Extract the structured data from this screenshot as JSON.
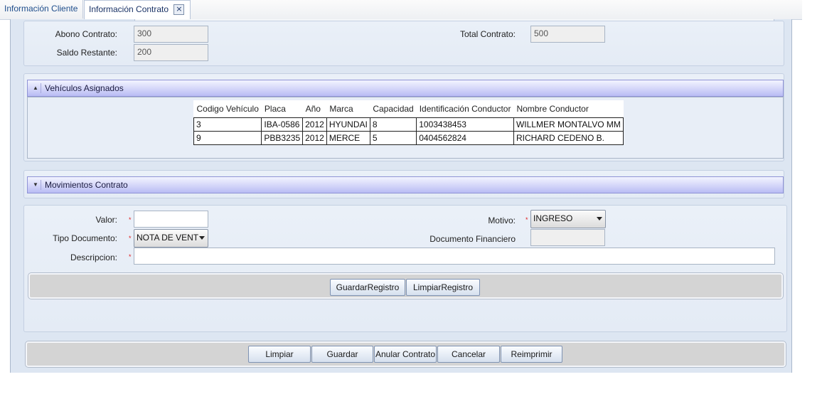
{
  "tabs": [
    {
      "label": "Información Cliente"
    },
    {
      "label": "Información Contrato",
      "close": "×"
    }
  ],
  "contract_summary": {
    "abono_label": "Abono Contrato:",
    "abono_value": "300",
    "total_label": "Total Contrato:",
    "total_value": "500",
    "saldo_label": "Saldo Restante:",
    "saldo_value": "200"
  },
  "vehiculos": {
    "title": "Vehículos Asignados",
    "expanded": true,
    "columns": [
      "Codigo Vehículo",
      "Placa",
      "Año",
      "Marca",
      "Capacidad",
      "Identificación Conductor",
      "Nombre Conductor"
    ],
    "rows": [
      [
        "3",
        "IBA-0586",
        "2012",
        "HYUNDAI",
        "8",
        "1003438453",
        "WILLMER MONTALVO MM"
      ],
      [
        "9",
        "PBB3235",
        "2012",
        "MERCE",
        "5",
        "0404562824",
        "RICHARD CEDENO B."
      ]
    ]
  },
  "movimientos": {
    "title": "Movimientos Contrato",
    "expanded": false
  },
  "form": {
    "valor_label": "Valor:",
    "valor_value": "",
    "motivo_label": "Motivo:",
    "motivo_value": "INGRESO",
    "tipo_doc_label": "Tipo Documento:",
    "tipo_doc_value": "NOTA DE VENT",
    "doc_fin_label": "Documento Financiero",
    "doc_fin_value": "",
    "descripcion_label": "Descripcion:",
    "descripcion_value": "",
    "required_mark": "*"
  },
  "record_buttons": {
    "guardar": "GuardarRegistro",
    "limpiar": "LimpiarRegistro"
  },
  "bottom_buttons": {
    "limpiar": "Limpiar",
    "guardar": "Guardar",
    "anular": "Anular Contrato",
    "cancelar": "Cancelar",
    "reimprimir": "Reimprimir"
  },
  "colors": {
    "section_header": "#b9bcf4",
    "content_bg": "#dde6f2",
    "required": "#e02020"
  }
}
